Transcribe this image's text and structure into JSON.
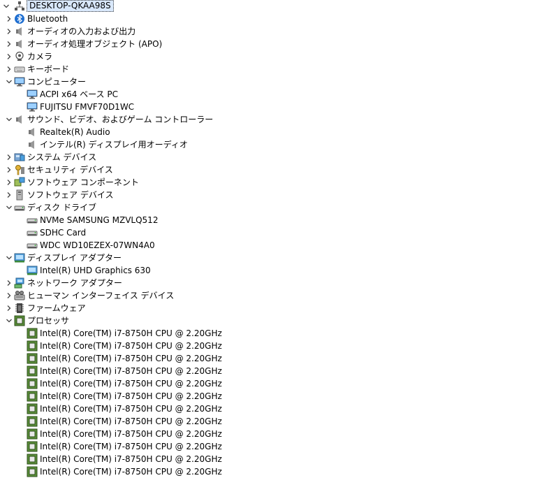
{
  "root": {
    "label": "DESKTOP-QKAA98S",
    "icon": "computer-network-icon"
  },
  "items": [
    {
      "label": "Bluetooth",
      "icon": "bluetooth-icon",
      "level": 1,
      "state": "collapsed"
    },
    {
      "label": "オーディオの入力および出力",
      "icon": "speaker-icon",
      "level": 1,
      "state": "collapsed"
    },
    {
      "label": "オーディオ処理オブジェクト (APO)",
      "icon": "speaker-icon",
      "level": 1,
      "state": "collapsed"
    },
    {
      "label": "カメラ",
      "icon": "camera-icon",
      "level": 1,
      "state": "collapsed"
    },
    {
      "label": "キーボード",
      "icon": "keyboard-icon",
      "level": 1,
      "state": "collapsed"
    },
    {
      "label": "コンピューター",
      "icon": "monitor-icon",
      "level": 1,
      "state": "expanded"
    },
    {
      "label": "ACPI x64 ベース PC",
      "icon": "monitor-icon",
      "level": 2,
      "state": "leaf"
    },
    {
      "label": "FUJITSU FMVF70D1WC",
      "icon": "monitor-icon",
      "level": 2,
      "state": "leaf"
    },
    {
      "label": "サウンド、ビデオ、およびゲーム コントローラー",
      "icon": "speaker-icon",
      "level": 1,
      "state": "expanded"
    },
    {
      "label": "Realtek(R) Audio",
      "icon": "speaker-icon",
      "level": 2,
      "state": "leaf"
    },
    {
      "label": "インテル(R) ディスプレイ用オーディオ",
      "icon": "speaker-icon",
      "level": 2,
      "state": "leaf"
    },
    {
      "label": "システム デバイス",
      "icon": "system-devices-icon",
      "level": 1,
      "state": "collapsed"
    },
    {
      "label": "セキュリティ デバイス",
      "icon": "security-key-icon",
      "level": 1,
      "state": "collapsed"
    },
    {
      "label": "ソフトウェア コンポーネント",
      "icon": "software-component-icon",
      "level": 1,
      "state": "collapsed"
    },
    {
      "label": "ソフトウェア デバイス",
      "icon": "software-device-icon",
      "level": 1,
      "state": "collapsed"
    },
    {
      "label": "ディスク ドライブ",
      "icon": "disk-drive-icon",
      "level": 1,
      "state": "expanded"
    },
    {
      "label": "NVMe SAMSUNG MZVLQ512",
      "icon": "disk-drive-icon",
      "level": 2,
      "state": "leaf"
    },
    {
      "label": "SDHC Card",
      "icon": "disk-drive-icon",
      "level": 2,
      "state": "leaf"
    },
    {
      "label": "WDC WD10EZEX-07WN4A0",
      "icon": "disk-drive-icon",
      "level": 2,
      "state": "leaf"
    },
    {
      "label": "ディスプレイ アダプター",
      "icon": "display-adapter-icon",
      "level": 1,
      "state": "expanded"
    },
    {
      "label": "Intel(R) UHD Graphics 630",
      "icon": "display-adapter-icon",
      "level": 2,
      "state": "leaf"
    },
    {
      "label": "ネットワーク アダプター",
      "icon": "network-adapter-icon",
      "level": 1,
      "state": "collapsed"
    },
    {
      "label": "ヒューマン インターフェイス デバイス",
      "icon": "hid-icon",
      "level": 1,
      "state": "collapsed"
    },
    {
      "label": "ファームウェア",
      "icon": "firmware-icon",
      "level": 1,
      "state": "collapsed"
    },
    {
      "label": "プロセッサ",
      "icon": "processor-icon",
      "level": 1,
      "state": "expanded"
    },
    {
      "label": "Intel(R) Core(TM) i7-8750H CPU @ 2.20GHz",
      "icon": "processor-icon",
      "level": 2,
      "state": "leaf"
    },
    {
      "label": "Intel(R) Core(TM) i7-8750H CPU @ 2.20GHz",
      "icon": "processor-icon",
      "level": 2,
      "state": "leaf"
    },
    {
      "label": "Intel(R) Core(TM) i7-8750H CPU @ 2.20GHz",
      "icon": "processor-icon",
      "level": 2,
      "state": "leaf"
    },
    {
      "label": "Intel(R) Core(TM) i7-8750H CPU @ 2.20GHz",
      "icon": "processor-icon",
      "level": 2,
      "state": "leaf"
    },
    {
      "label": "Intel(R) Core(TM) i7-8750H CPU @ 2.20GHz",
      "icon": "processor-icon",
      "level": 2,
      "state": "leaf"
    },
    {
      "label": "Intel(R) Core(TM) i7-8750H CPU @ 2.20GHz",
      "icon": "processor-icon",
      "level": 2,
      "state": "leaf"
    },
    {
      "label": "Intel(R) Core(TM) i7-8750H CPU @ 2.20GHz",
      "icon": "processor-icon",
      "level": 2,
      "state": "leaf"
    },
    {
      "label": "Intel(R) Core(TM) i7-8750H CPU @ 2.20GHz",
      "icon": "processor-icon",
      "level": 2,
      "state": "leaf"
    },
    {
      "label": "Intel(R) Core(TM) i7-8750H CPU @ 2.20GHz",
      "icon": "processor-icon",
      "level": 2,
      "state": "leaf"
    },
    {
      "label": "Intel(R) Core(TM) i7-8750H CPU @ 2.20GHz",
      "icon": "processor-icon",
      "level": 2,
      "state": "leaf"
    },
    {
      "label": "Intel(R) Core(TM) i7-8750H CPU @ 2.20GHz",
      "icon": "processor-icon",
      "level": 2,
      "state": "leaf"
    },
    {
      "label": "Intel(R) Core(TM) i7-8750H CPU @ 2.20GHz",
      "icon": "processor-icon",
      "level": 2,
      "state": "leaf"
    }
  ]
}
